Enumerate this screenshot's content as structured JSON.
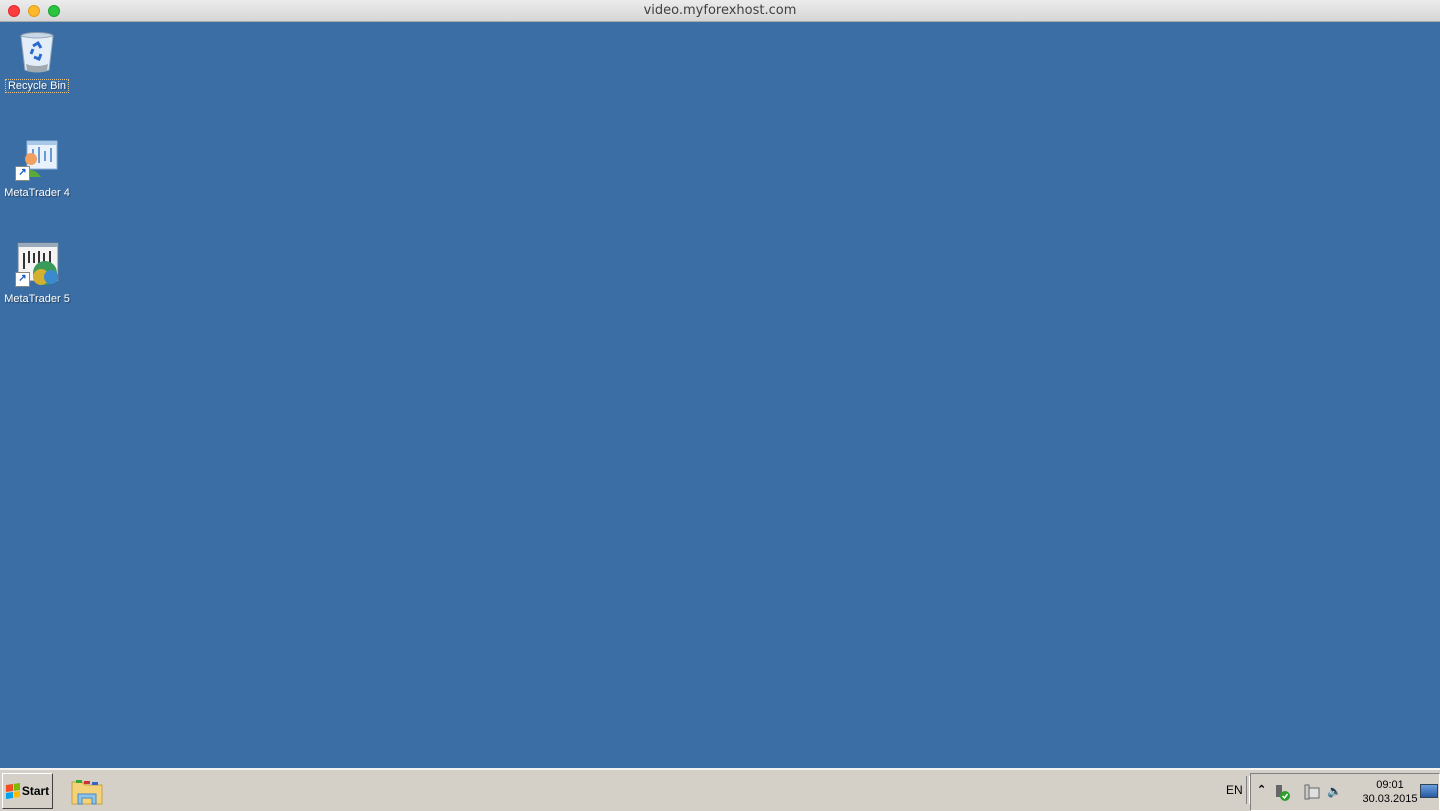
{
  "window": {
    "title": "video.myforexhost.com",
    "controls": [
      "close",
      "minimize",
      "maximize"
    ]
  },
  "desktop": {
    "background_color": "#3a6ea5",
    "icons": [
      {
        "label": "Recycle Bin",
        "icon": "recycle-bin-icon",
        "selected": true,
        "shortcut": false
      },
      {
        "label": "MetaTrader 4",
        "icon": "metatrader4-icon",
        "selected": false,
        "shortcut": true
      },
      {
        "label": "MetaTrader 5",
        "icon": "metatrader5-icon",
        "selected": false,
        "shortcut": true
      }
    ]
  },
  "taskbar": {
    "start_label": "Start",
    "pinned": [
      {
        "name": "Windows Explorer",
        "icon": "folder-explorer-icon"
      }
    ],
    "language": "EN",
    "tray_icons": [
      "show-hidden-icons-chevron",
      "safely-remove-hardware-icon",
      "network-icon",
      "volume-icon"
    ],
    "clock": {
      "time": "09:01",
      "date": "30.03.2015"
    },
    "show_desktop": "show-desktop-icon"
  }
}
